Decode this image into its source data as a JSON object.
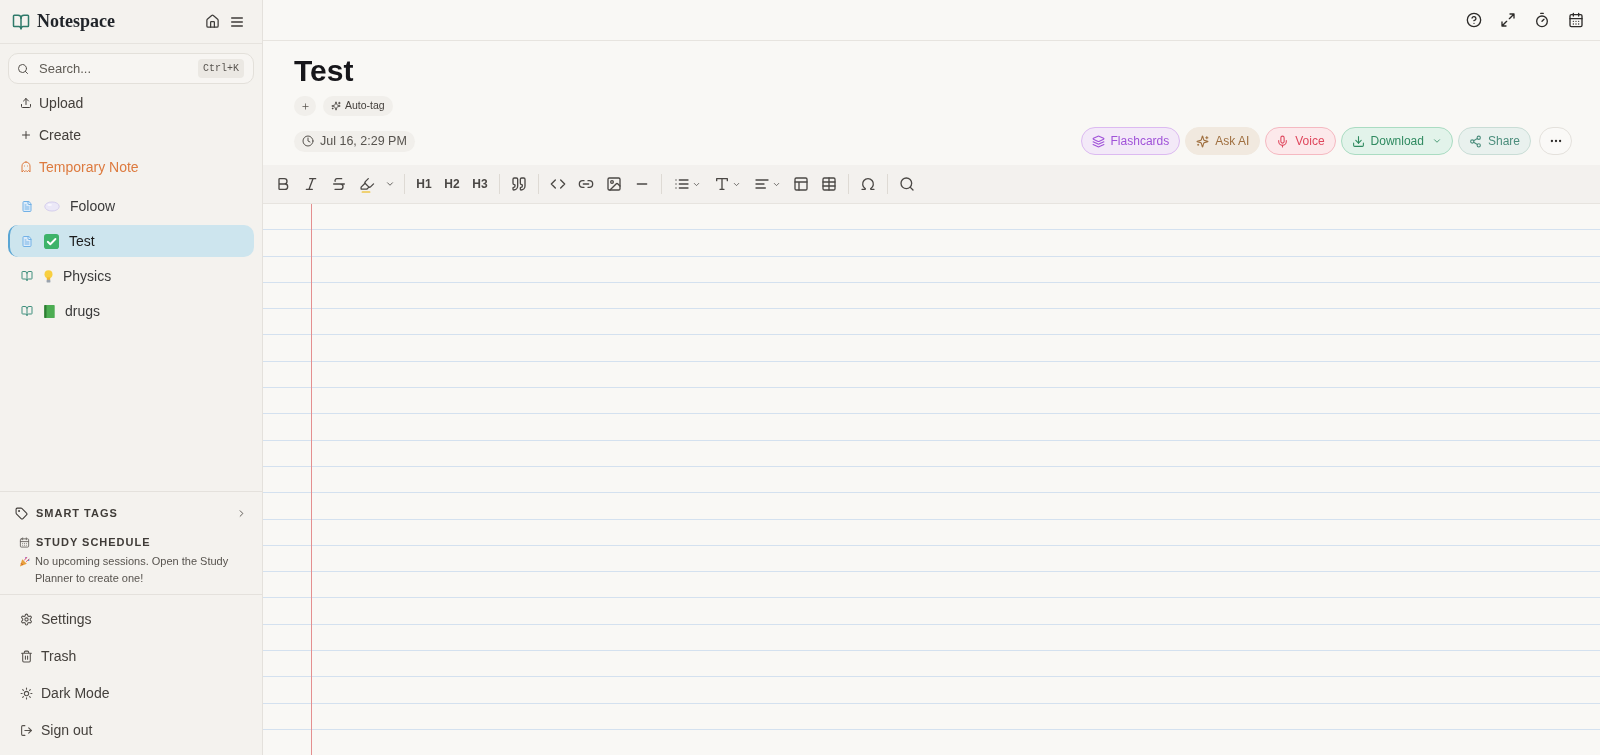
{
  "sidebar": {
    "app_name": "Notespace",
    "search": {
      "placeholder": "Search...",
      "shortcut": "Ctrl+K"
    },
    "actions": [
      {
        "label": "Upload",
        "kind": "upload"
      },
      {
        "label": "Create",
        "kind": "create"
      },
      {
        "label": "Temporary Note",
        "kind": "temporary"
      }
    ],
    "notes": [
      {
        "title": "Foloow",
        "kind": "note",
        "selected": false
      },
      {
        "title": "Test",
        "kind": "note",
        "selected": true
      },
      {
        "title": "Physics",
        "kind": "notebook",
        "selected": false
      },
      {
        "title": "drugs",
        "kind": "notebook",
        "selected": false
      }
    ],
    "smart_tags": {
      "label": "SMART TAGS",
      "expanded": false
    },
    "study_schedule": {
      "label": "STUDY SCHEDULE",
      "message": "No upcoming sessions. Open the Study Planner to create one!"
    },
    "footer_items": [
      {
        "label": "Settings",
        "kind": "settings"
      },
      {
        "label": "Trash",
        "kind": "trash"
      },
      {
        "label": "Dark Mode",
        "kind": "theme"
      },
      {
        "label": "Sign out",
        "kind": "sign-out"
      }
    ]
  },
  "note": {
    "title": "Test",
    "auto_tag_label": "Auto-tag",
    "date": "Jul 16, 2:29 PM",
    "actions": [
      {
        "label": "Flashcards",
        "kind": "flashcards"
      },
      {
        "label": "Ask AI",
        "kind": "ask-ai"
      },
      {
        "label": "Voice",
        "kind": "voice"
      },
      {
        "label": "Download",
        "kind": "download"
      },
      {
        "label": "Share",
        "kind": "share"
      }
    ]
  },
  "toolbar": {
    "headings": [
      "H1",
      "H2",
      "H3"
    ]
  }
}
